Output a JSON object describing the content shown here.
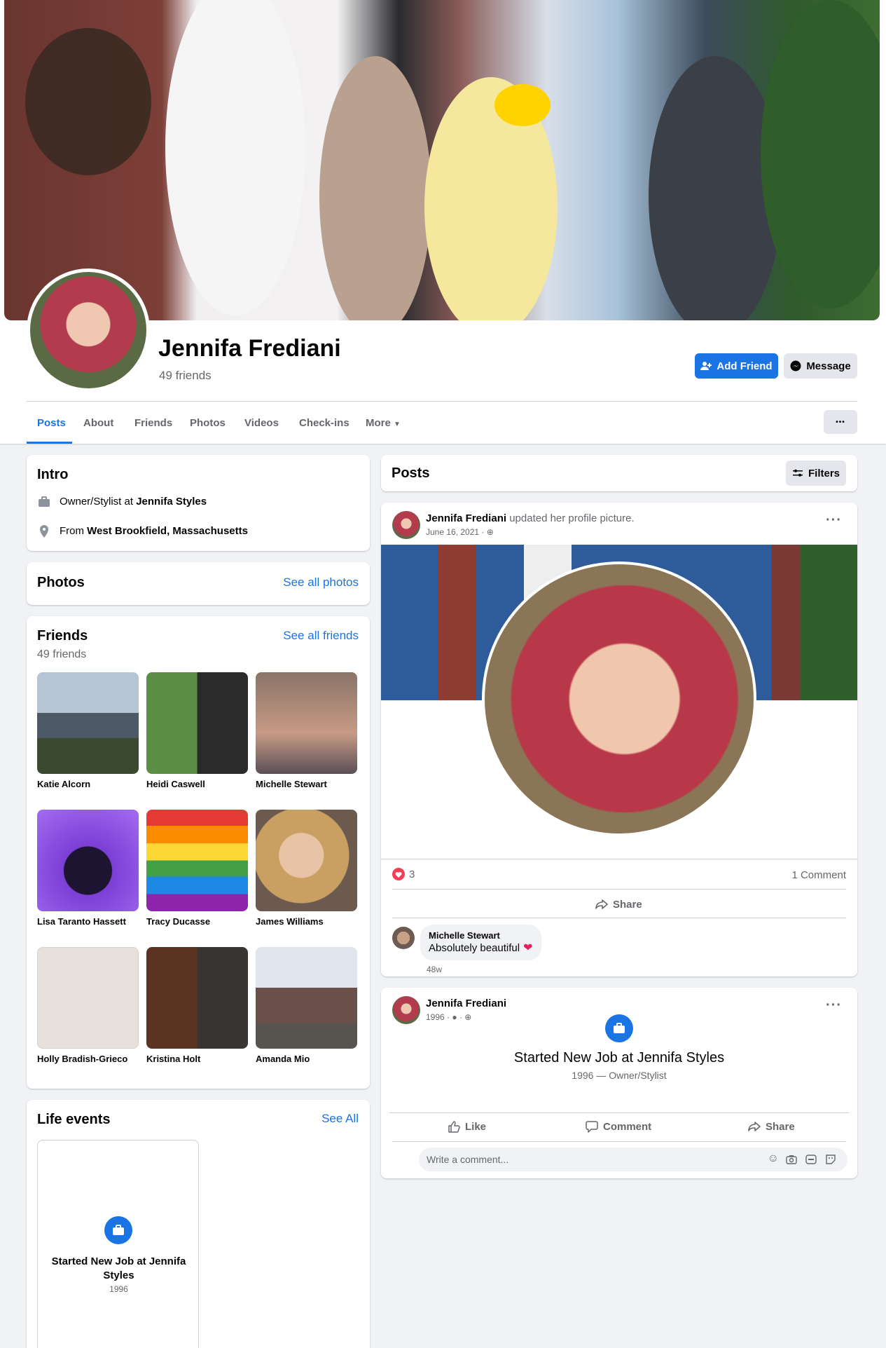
{
  "profile": {
    "name": "Jennifa Frediani",
    "friend_count": "49 friends",
    "add_friend_label": "Add Friend",
    "message_label": "Message",
    "more_dots": "•••"
  },
  "tabs": [
    "Posts",
    "About",
    "Friends",
    "Photos",
    "Videos",
    "Check-ins",
    "More"
  ],
  "intro": {
    "title": "Intro",
    "work_prefix": "Owner/Stylist at ",
    "work_place": "Jennifa Styles",
    "from_prefix": "From ",
    "from_place": "West Brookfield, Massachusetts"
  },
  "photos": {
    "title": "Photos",
    "see_all": "See all photos"
  },
  "friends": {
    "title": "Friends",
    "count": "49 friends",
    "see_all": "See all friends",
    "list": [
      "Katie Alcorn",
      "Heidi Caswell",
      "Michelle Stewart",
      "Lisa Taranto Hassett",
      "Tracy Ducasse",
      "James Williams",
      "Holly Bradish-Grieco",
      "Kristina Holt",
      "Amanda Mio"
    ]
  },
  "life_events": {
    "title": "Life events",
    "see_all": "See All",
    "event_title": "Started New Job at Jennifa Styles",
    "event_year": "1996"
  },
  "posts_header": {
    "title": "Posts",
    "filters_label": "Filters"
  },
  "post1": {
    "author": "Jennifa Frediani",
    "action": " updated her profile picture.",
    "date": "June 16, 2021 · ",
    "reaction_count": "3",
    "comment_count": "1 Comment",
    "share_label": "Share",
    "comment_author": "Michelle Stewart",
    "comment_text": "Absolutely beautiful",
    "comment_age": "48w"
  },
  "post2": {
    "author": "Jennifa Frediani",
    "date": "1996 · ",
    "event_title": "Started New Job at Jennifa Styles",
    "event_sub": "1996 — Owner/Stylist",
    "like_label": "Like",
    "comment_label": "Comment",
    "share_label": "Share",
    "write_placeholder": "Write a comment..."
  }
}
